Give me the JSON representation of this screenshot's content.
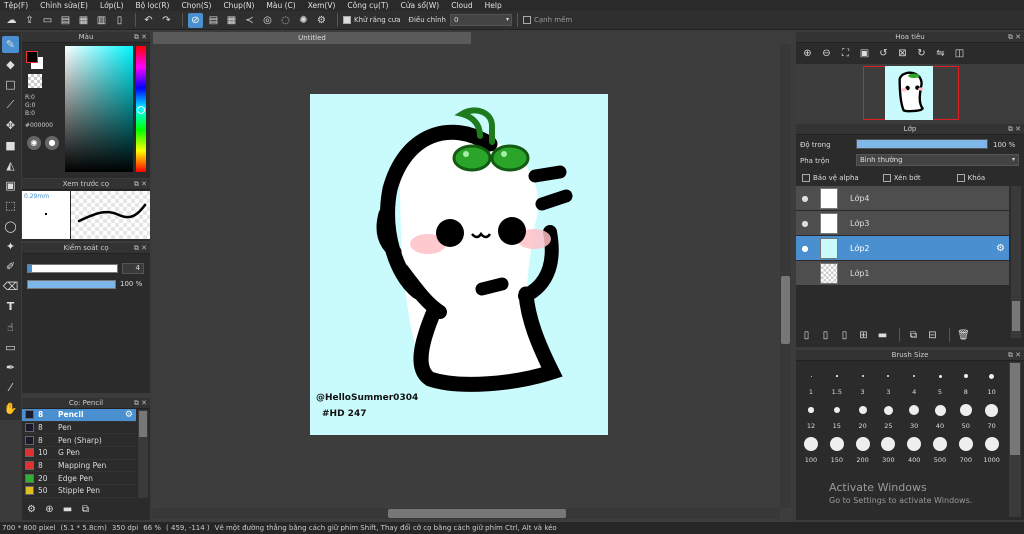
{
  "menu": [
    "Tệp(F)",
    "Chỉnh sửa(E)",
    "Lớp(L)",
    "Bộ lọc(R)",
    "Chọn(S)",
    "Chụp(N)",
    "Màu (C)",
    "Xem(V)",
    "Công cụ(T)",
    "Cửa sổ(W)",
    "Cloud",
    "Help"
  ],
  "toolbar": {
    "antialias_label": "Khử răng cưa",
    "adjust_label": "Điều chỉnh",
    "adjust_value": "0",
    "edge_label": "Cạnh mềm"
  },
  "color_panel": {
    "title": "Màu",
    "r": "R:0",
    "g": "G:0",
    "b": "B:0",
    "hex": "#000000",
    "fg": "#000000",
    "bg": "#ffffff"
  },
  "brush_preview": {
    "title": "Xem trước cọ",
    "size": "0.29mm"
  },
  "brush_control": {
    "title": "Kiểm soát cọ",
    "size": "4",
    "opacity": "100 %"
  },
  "brush_list": {
    "title": "Cọ: Pencil",
    "items": [
      {
        "size": "8",
        "name": "Pencil",
        "color": "#1a1a2e"
      },
      {
        "size": "8",
        "name": "Pen",
        "color": "#1a1a2e"
      },
      {
        "size": "8",
        "name": "Pen (Sharp)",
        "color": "#1a1a2e"
      },
      {
        "size": "10",
        "name": "G Pen",
        "color": "#e03030"
      },
      {
        "size": "8",
        "name": "Mapping Pen",
        "color": "#e03030"
      },
      {
        "size": "20",
        "name": "Edge Pen",
        "color": "#30b030"
      },
      {
        "size": "50",
        "name": "Stipple Pen",
        "color": "#e0c020"
      }
    ]
  },
  "canvas": {
    "tab": "Untitled",
    "signature": "@HelloSummer0304",
    "tag": "#HD 247"
  },
  "navigator": {
    "title": "Hoa tiêu"
  },
  "layers": {
    "title": "Lớp",
    "opacity_label": "Độ trong",
    "opacity_value": "100 %",
    "blend_label": "Pha trộn",
    "blend_value": "Bình thường",
    "protect_alpha": "Bảo vệ alpha",
    "clipping": "Xén bớt",
    "lock": "Khóa",
    "items": [
      "Lớp4",
      "Lớp3",
      "Lớp2",
      "Lớp1"
    ]
  },
  "brush_size": {
    "title": "Brush Size",
    "sizes": [
      "1",
      "1.5",
      "3",
      "3",
      "4",
      "5",
      "8",
      "10",
      "12",
      "15",
      "20",
      "25",
      "30",
      "40",
      "50",
      "70",
      "100",
      "150",
      "200",
      "300",
      "400",
      "500",
      "700",
      "1000"
    ]
  },
  "watermark": {
    "line1": "Activate Windows",
    "line2": "Go to Settings to activate Windows."
  },
  "status": {
    "size": "700 * 800 pixel",
    "cm": "(5.1 * 5.8cm)",
    "dpi": "350 dpi",
    "zoom": "66 %",
    "coords": "( 459, -114 )",
    "hint": "Vẽ một đường thẳng bằng cách giữ phím Shift, Thay đổi cỡ cọ bằng cách giữ phím Ctrl, Alt và kéo"
  }
}
